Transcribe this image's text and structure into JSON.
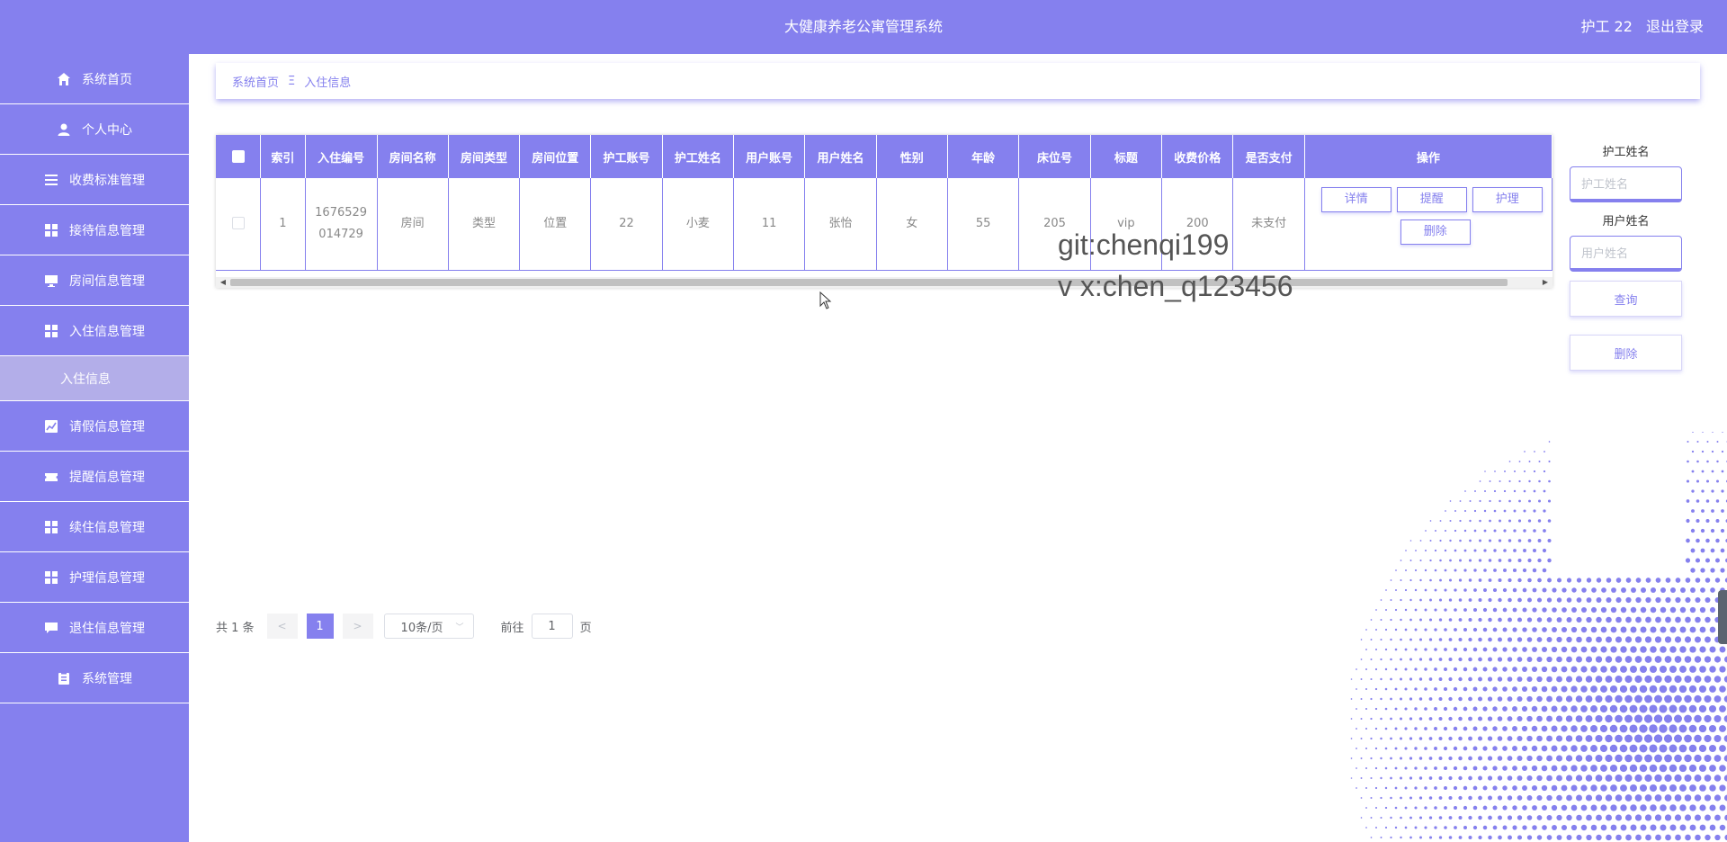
{
  "header": {
    "title": "大健康养老公寓管理系统",
    "user_label": "护工 22",
    "logout_label": "退出登录"
  },
  "sidebar": {
    "items": [
      {
        "label": "系统首页",
        "icon": "home-icon"
      },
      {
        "label": "个人中心",
        "icon": "user-icon"
      },
      {
        "label": "收费标准管理",
        "icon": "list-icon"
      },
      {
        "label": "接待信息管理",
        "icon": "grid-icon"
      },
      {
        "label": "房间信息管理",
        "icon": "monitor-icon"
      },
      {
        "label": "入住信息管理",
        "icon": "grid-icon"
      },
      {
        "label": "请假信息管理",
        "icon": "chart-icon"
      },
      {
        "label": "提醒信息管理",
        "icon": "ticket-icon"
      },
      {
        "label": "续住信息管理",
        "icon": "grid-icon"
      },
      {
        "label": "护理信息管理",
        "icon": "grid-icon"
      },
      {
        "label": "退住信息管理",
        "icon": "chat-icon"
      },
      {
        "label": "系统管理",
        "icon": "clipboard-icon"
      }
    ],
    "active_sub": "入住信息"
  },
  "breadcrumb": {
    "home": "系统首页",
    "separator": "Ξ",
    "current": "入住信息"
  },
  "table": {
    "headers": [
      "索引",
      "入住编号",
      "房间名称",
      "房间类型",
      "房间位置",
      "护工账号",
      "护工姓名",
      "用户账号",
      "用户姓名",
      "性别",
      "年龄",
      "床位号",
      "标题",
      "收费价格",
      "是否支付",
      "操作"
    ],
    "rows": [
      {
        "index": "1",
        "checkin_no_1": "1676529",
        "checkin_no_2": "014729",
        "room_name": "房间",
        "room_type": "类型",
        "room_location": "位置",
        "nurse_account": "22",
        "nurse_name": "小麦",
        "user_account": "11",
        "user_name": "张怡",
        "gender": "女",
        "age": "55",
        "bed_no": "205",
        "title": "vip",
        "price": "200",
        "paid": "未支付"
      }
    ],
    "actions": {
      "detail": "详情",
      "remind": "提醒",
      "nursing": "护理",
      "delete": "删除"
    }
  },
  "watermark": {
    "line1": "git:chenqi199",
    "line2": "v x:chen_q123456"
  },
  "search": {
    "nurse_label": "护工姓名",
    "nurse_placeholder": "护工姓名",
    "user_label": "用户姓名",
    "user_placeholder": "用户姓名",
    "query_button": "查询",
    "delete_button": "删除"
  },
  "pagination": {
    "total": "共 1 条",
    "prev": "<",
    "current_page": "1",
    "next": ">",
    "page_size": "10条/页",
    "goto_label": "前往",
    "goto_value": "1",
    "page_suffix": "页"
  },
  "colors": {
    "primary": "#8580ee",
    "submenu_active": "#b3aee9"
  }
}
